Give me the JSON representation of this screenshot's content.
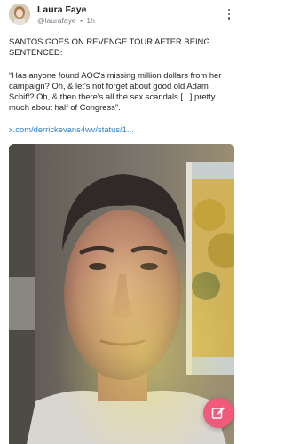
{
  "author": {
    "name": "Laura Faye",
    "handle": "@laurafaye",
    "separator": "•",
    "time": "1h"
  },
  "post": {
    "headline": "SANTOS GOES ON REVENGE TOUR AFTER BEING SENTENCED:",
    "quote": "“Has anyone found AOC's missing million dollars from her campaign? Oh, & let's not forget about good old Adam Schiff? Oh, & then there's all the sex scandals [...] pretty much about half of Congress”.",
    "link": "x.com/derrickevans4wv/status/1..."
  },
  "icons": {
    "more": "vertical-ellipsis-icon",
    "compose": "pencil-edit-icon"
  },
  "colors": {
    "link": "#2f7ec4",
    "fab": "#f25a7c"
  }
}
